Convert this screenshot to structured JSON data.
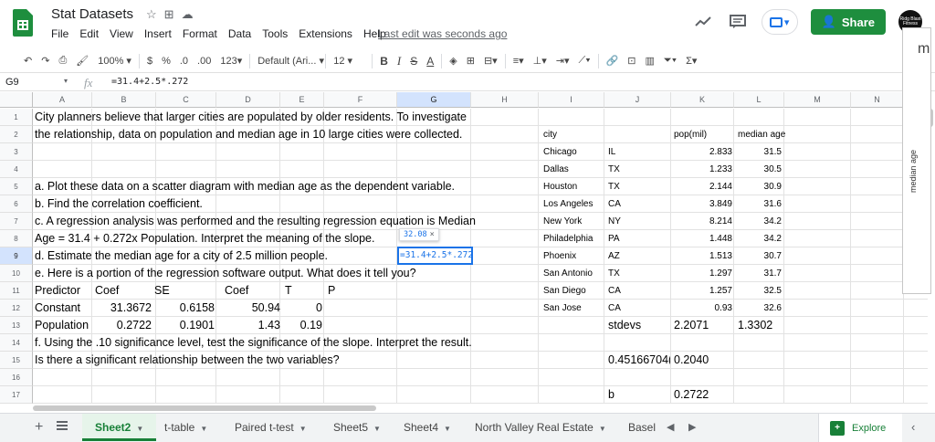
{
  "app": {
    "title": "Stat Datasets",
    "menu": [
      "File",
      "Edit",
      "View",
      "Insert",
      "Format",
      "Data",
      "Tools",
      "Extensions",
      "Help"
    ],
    "last_edit": "Last edit was seconds ago",
    "share_label": "Share",
    "avatar_text": "Ridg Blast Fitness"
  },
  "toolbar": {
    "zoom": "100%",
    "currency": "$",
    "percent": "%",
    "dec_less": ".0",
    "dec_more": ".00",
    "format_more": "123",
    "font": "Default (Ari...",
    "font_size": "12",
    "bold": "B",
    "italic": "I",
    "strike": "S",
    "text_color": "A"
  },
  "formula_bar": {
    "cell_ref": "G9",
    "fx": "fx",
    "formula": "=31.4+2.5*.272"
  },
  "grid": {
    "columns": [
      "A",
      "B",
      "C",
      "D",
      "E",
      "F",
      "G",
      "H",
      "I",
      "J",
      "K",
      "L",
      "M",
      "N"
    ],
    "rows": [
      "1",
      "2",
      "3",
      "4",
      "5",
      "6",
      "7",
      "8",
      "9",
      "10",
      "11",
      "12",
      "13",
      "14",
      "15",
      "16",
      "17"
    ],
    "selected_col": "G",
    "selected_row": "9"
  },
  "text_cells": {
    "r1": "City planners believe that larger cities are populated by older residents. To investigate",
    "r2": "the relationship, data on population and median age in 10 large cities were collected.",
    "r5": "a. Plot these data on a scatter diagram with median age as the dependent variable.",
    "r6": "b. Find the correlation coefficient.",
    "r7": "c. A regression analysis was performed and the resulting regression equation is Median",
    "r8": "Age = 31.4 + 0.272x Population. Interpret the meaning of the slope.",
    "r9": "d. Estimate the median age for a city of 2.5 million people.",
    "r10": "e. Here is a portion of the regression software output. What does it tell you?",
    "r14": "f. Using the .10 significance level, test the significance of the slope. Interpret the result.",
    "r15": "Is there a significant relationship between the two variables?"
  },
  "regression_table": {
    "headers": [
      "Predictor",
      "Coef",
      "SE",
      "Coef",
      "T",
      "P"
    ],
    "constant": [
      "Constant",
      "31.3672",
      "0.6158",
      "50.94",
      "0"
    ],
    "population": [
      "Population",
      "0.2722",
      "0.1901",
      "1.43",
      "0.19"
    ]
  },
  "selected_cell": {
    "value": "=31.4+2.5*.272",
    "tooltip": "32.08",
    "tooltip_close": "×"
  },
  "dataset": {
    "headers": [
      "city",
      "pop(mil)",
      "median age"
    ],
    "rows": [
      [
        "Chicago",
        "IL",
        "2.833",
        "31.5"
      ],
      [
        "Dallas",
        "TX",
        "1.233",
        "30.5"
      ],
      [
        "Houston",
        "TX",
        "2.144",
        "30.9"
      ],
      [
        "Los Angeles",
        "CA",
        "3.849",
        "31.6"
      ],
      [
        "New York",
        "NY",
        "8.214",
        "34.2"
      ],
      [
        "Philadelphia",
        "PA",
        "1.448",
        "34.2"
      ],
      [
        "Phoenix",
        "AZ",
        "1.513",
        "30.7"
      ],
      [
        "San Antonio",
        "TX",
        "1.297",
        "31.7"
      ],
      [
        "San Diego",
        "CA",
        "1.257",
        "32.5"
      ],
      [
        "San Jose",
        "CA",
        "0.93",
        "32.6"
      ]
    ],
    "stdevs_label": "stdevs",
    "stdev_pop": "2.2071",
    "stdev_age": "1.3302",
    "r15_j": "0.45166704(",
    "r15_k": "0.2040",
    "b_label": "b",
    "b_value": "0.2722"
  },
  "chart_panel": {
    "ylabel": "median age",
    "title_fragment": "m"
  },
  "sheet_tabs": [
    {
      "label": "Sheet2",
      "active": true
    },
    {
      "label": "t-table",
      "active": false
    },
    {
      "label": "Paired t-test",
      "active": false
    },
    {
      "label": "Sheet5",
      "active": false
    },
    {
      "label": "Sheet4",
      "active": false
    },
    {
      "label": "North Valley Real Estate",
      "active": false
    },
    {
      "label": "Basel",
      "active": false
    }
  ],
  "explore_label": "Explore",
  "colors": {
    "brand_green": "#1e8e3e",
    "selection_blue": "#1a73e8",
    "active_tab_green": "#188038"
  }
}
